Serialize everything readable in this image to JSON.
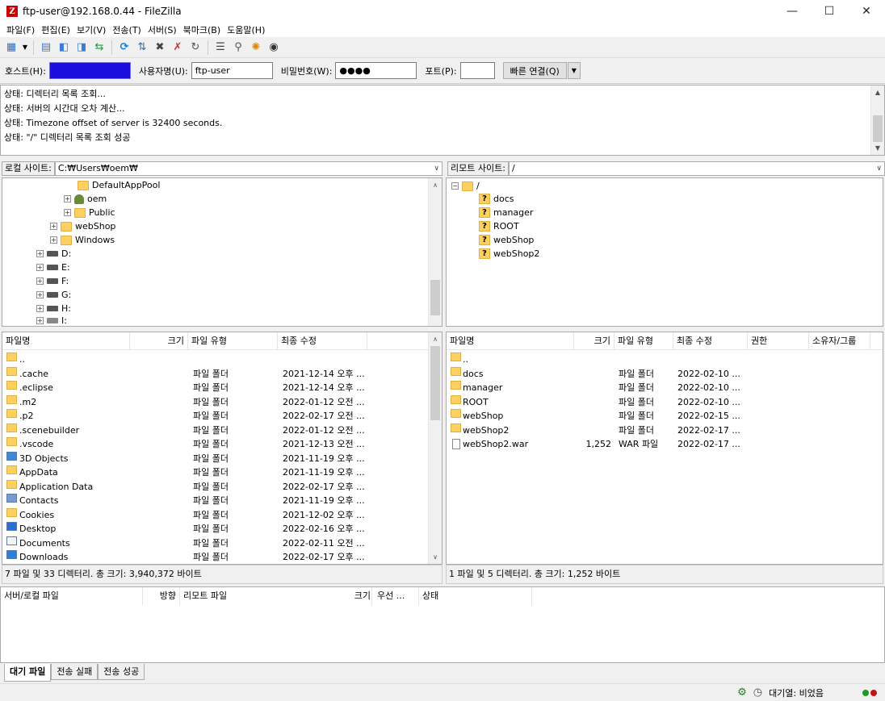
{
  "window": {
    "title": "ftp-user@192.168.0.44 - FileZilla",
    "icon": "Z"
  },
  "menu": [
    "파일(F)",
    "편집(E)",
    "보기(V)",
    "전송(T)",
    "서버(S)",
    "북마크(B)",
    "도움말(H)"
  ],
  "quickconnect": {
    "host_label": "호스트(H):",
    "host_value": "",
    "user_label": "사용자명(U):",
    "user_value": "ftp-user",
    "pass_label": "비밀번호(W):",
    "pass_value": "●●●●",
    "port_label": "포트(P):",
    "port_value": "",
    "connect_label": "빠른 연결(Q)"
  },
  "log": [
    "상태:   디렉터리 목록 조회...",
    "상태:   서버의 시간대 오차 계산...",
    "상태:   Timezone offset of server is 32400 seconds.",
    "상태:   \"/\" 디렉터리 목록 조회 성공"
  ],
  "local": {
    "label": "로컬 사이트:",
    "path": "C:₩Users₩oem₩",
    "tree": [
      "DefaultAppPool",
      "oem",
      "Public",
      "webShop",
      "Windows",
      "D:",
      "E:",
      "F:",
      "G:",
      "H:",
      "I:"
    ],
    "headers": [
      "파일명",
      "크기",
      "파일 유형",
      "최종 수정"
    ],
    "files": [
      {
        "name": "..",
        "type": "",
        "modified": ""
      },
      {
        "name": ".cache",
        "type": "파일 폴더",
        "modified": "2021-12-14 오후 ..."
      },
      {
        "name": ".eclipse",
        "type": "파일 폴더",
        "modified": "2021-12-14 오후 ..."
      },
      {
        "name": ".m2",
        "type": "파일 폴더",
        "modified": "2022-01-12 오전 ..."
      },
      {
        "name": ".p2",
        "type": "파일 폴더",
        "modified": "2022-02-17 오전 ..."
      },
      {
        "name": ".scenebuilder",
        "type": "파일 폴더",
        "modified": "2022-01-12 오전 ..."
      },
      {
        "name": ".vscode",
        "type": "파일 폴더",
        "modified": "2021-12-13 오전 ..."
      },
      {
        "name": "3D Objects",
        "type": "파일 폴더",
        "modified": "2021-11-19 오후 ..."
      },
      {
        "name": "AppData",
        "type": "파일 폴더",
        "modified": "2021-11-19 오후 ..."
      },
      {
        "name": "Application Data",
        "type": "파일 폴더",
        "modified": "2022-02-17 오후 ..."
      },
      {
        "name": "Contacts",
        "type": "파일 폴더",
        "modified": "2021-11-19 오후 ..."
      },
      {
        "name": "Cookies",
        "type": "파일 폴더",
        "modified": "2021-12-02 오후 ..."
      },
      {
        "name": "Desktop",
        "type": "파일 폴더",
        "modified": "2022-02-16 오후 ..."
      },
      {
        "name": "Documents",
        "type": "파일 폴더",
        "modified": "2022-02-11 오전 ..."
      },
      {
        "name": "Downloads",
        "type": "파일 폴더",
        "modified": "2022-02-17 오후 ..."
      }
    ],
    "status": "7 파일 및 33 디렉터리. 총 크기: 3,940,372 바이트"
  },
  "remote": {
    "label": "리모트 사이트:",
    "path": "/",
    "tree": [
      "/",
      "docs",
      "manager",
      "ROOT",
      "webShop",
      "webShop2"
    ],
    "headers": [
      "파일명",
      "크기",
      "파일 유형",
      "최종 수정",
      "권한",
      "소유자/그룹"
    ],
    "files": [
      {
        "name": "..",
        "size": "",
        "type": "",
        "modified": ""
      },
      {
        "name": "docs",
        "size": "",
        "type": "파일 폴더",
        "modified": "2022-02-10 ..."
      },
      {
        "name": "manager",
        "size": "",
        "type": "파일 폴더",
        "modified": "2022-02-10 ..."
      },
      {
        "name": "ROOT",
        "size": "",
        "type": "파일 폴더",
        "modified": "2022-02-10 ..."
      },
      {
        "name": "webShop",
        "size": "",
        "type": "파일 폴더",
        "modified": "2022-02-15 ..."
      },
      {
        "name": "webShop2",
        "size": "",
        "type": "파일 폴더",
        "modified": "2022-02-17 ..."
      },
      {
        "name": "webShop2.war",
        "size": "1,252",
        "type": "WAR 파일",
        "modified": "2022-02-17 ..."
      }
    ],
    "status": "1 파일 및 5 디렉터리. 총 크기: 1,252 바이트"
  },
  "queue": {
    "headers": [
      "서버/로컬 파일",
      "방향",
      "리모트 파일",
      "크기",
      "우선 ...",
      "상태"
    ],
    "tabs": [
      "대기 파일",
      "전송 실패",
      "전송 성공"
    ]
  },
  "statusbar": {
    "queue_text": "대기열: 비었음"
  }
}
